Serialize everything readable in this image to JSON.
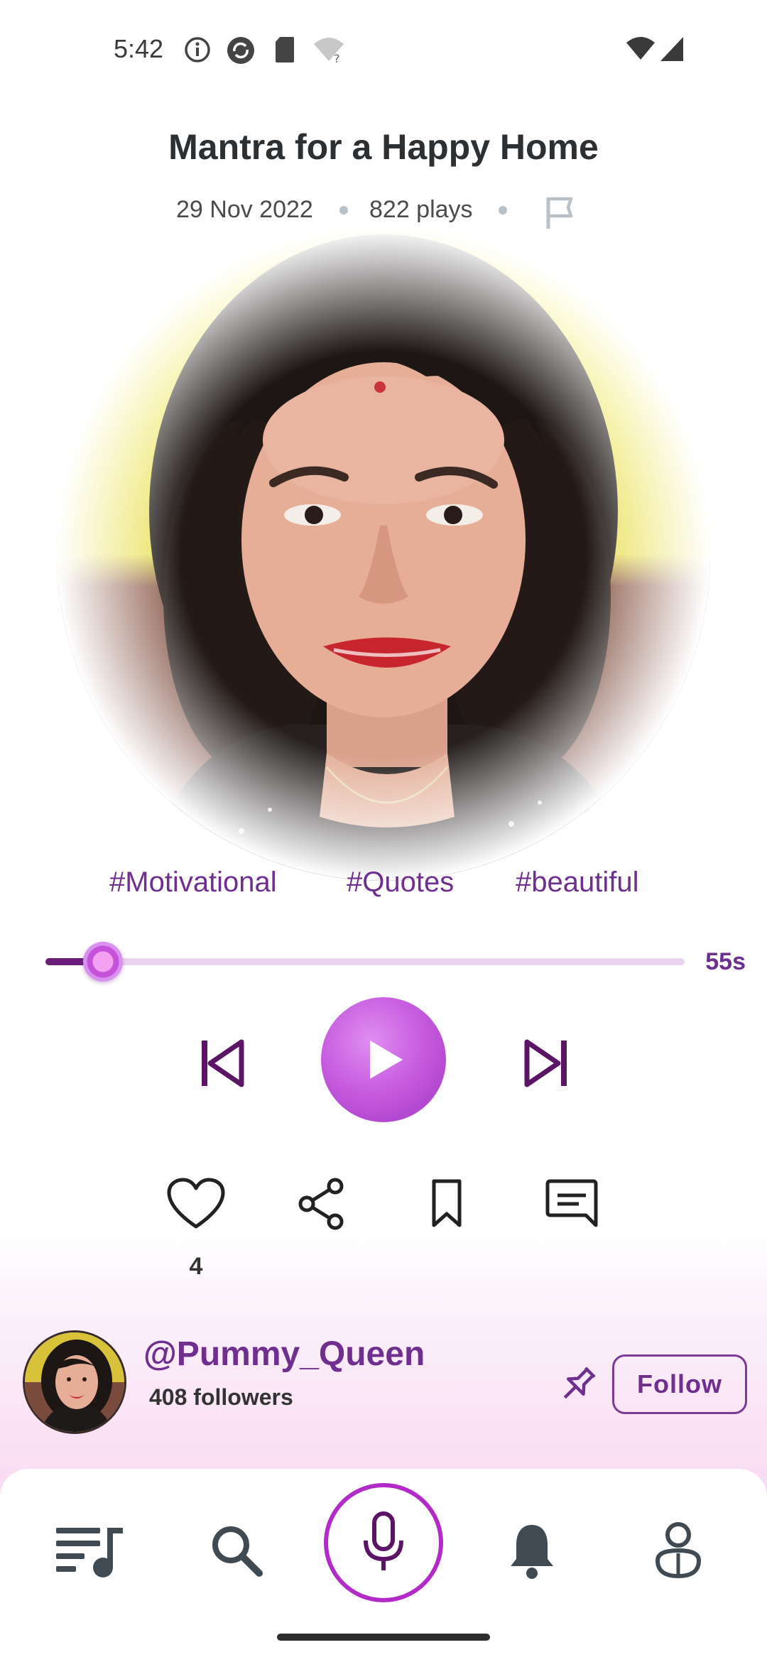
{
  "status_bar": {
    "time": "5:42",
    "icons_left": [
      "info-icon",
      "sync-icon",
      "sd-card-icon",
      "wifi-question-icon"
    ],
    "icons_right": [
      "wifi-icon",
      "cell-signal-icon"
    ]
  },
  "track": {
    "title": "Mantra for a Happy Home",
    "date": "29 Nov 2022",
    "plays": "822 plays"
  },
  "tags": [
    "#Motivational",
    "#Quotes",
    "#beautiful"
  ],
  "player": {
    "progress_fraction": 0.09,
    "remaining_time": "55s",
    "state": "paused"
  },
  "actions": {
    "like_count": "4",
    "items": [
      "like",
      "share",
      "bookmark",
      "comment"
    ]
  },
  "creator": {
    "username": "@Pummy_Queen",
    "followers": "408 followers",
    "follow_label": "Follow"
  },
  "bottom_nav": {
    "items": [
      "playlist",
      "search",
      "record",
      "notifications",
      "profile"
    ]
  },
  "colors": {
    "accent_purple": "#6e2f8e",
    "play_button": "#c85de0",
    "progress_track": "#ecd3f2",
    "progress_fill": "#6a1e7a",
    "mic_ring": "#b22bc9"
  }
}
